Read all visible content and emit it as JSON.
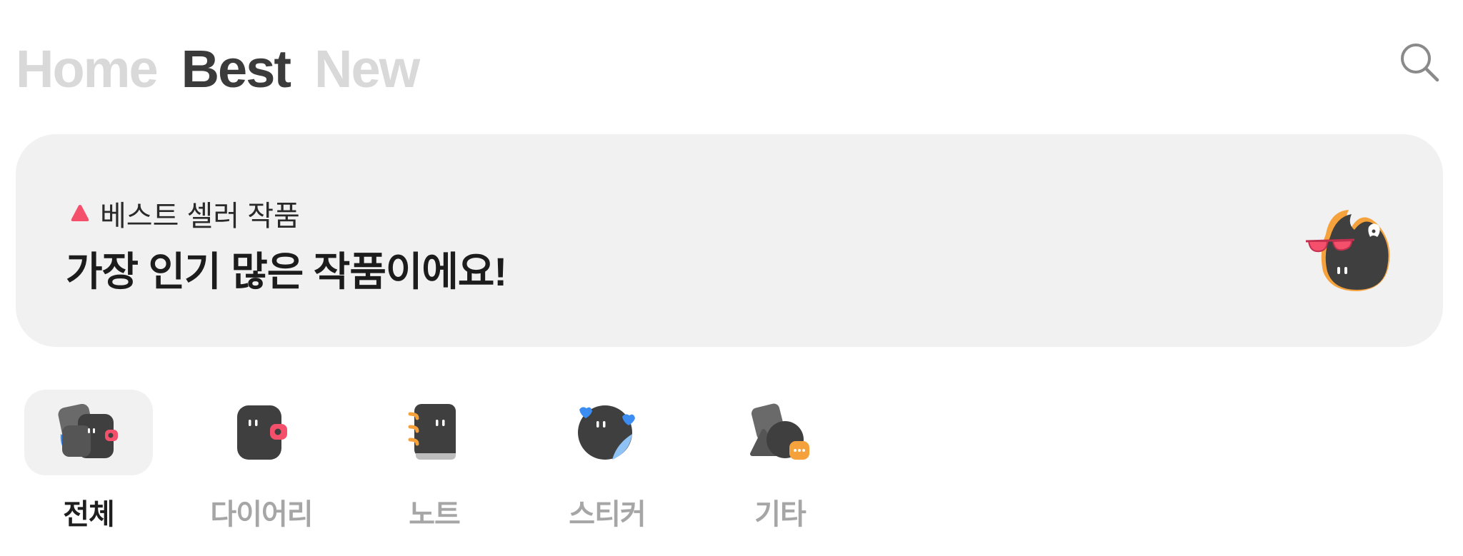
{
  "nav": {
    "tabs": [
      {
        "label": "Home",
        "active": false
      },
      {
        "label": "Best",
        "active": true
      },
      {
        "label": "New",
        "active": false
      }
    ],
    "search_icon": "search-icon"
  },
  "banner": {
    "eyebrow": "베스트 셀러 작품",
    "headline": "가장 인기 많은 작품이에요!",
    "mascot_icon": "fire-mascot-with-sunglasses",
    "triangle_color": "#f4506b"
  },
  "categories": [
    {
      "label": "전체",
      "icon": "all-category-icon",
      "selected": true
    },
    {
      "label": "다이어리",
      "icon": "diary-icon",
      "selected": false
    },
    {
      "label": "노트",
      "icon": "note-icon",
      "selected": false
    },
    {
      "label": "스티커",
      "icon": "sticker-icon",
      "selected": false
    },
    {
      "label": "기타",
      "icon": "etc-icon",
      "selected": false
    }
  ],
  "colors": {
    "accent_pink": "#f4506b",
    "accent_blue": "#3b8df1",
    "accent_orange": "#f5a13c",
    "dark": "#3f3f3f",
    "inactive_text": "#a6a6a6"
  }
}
